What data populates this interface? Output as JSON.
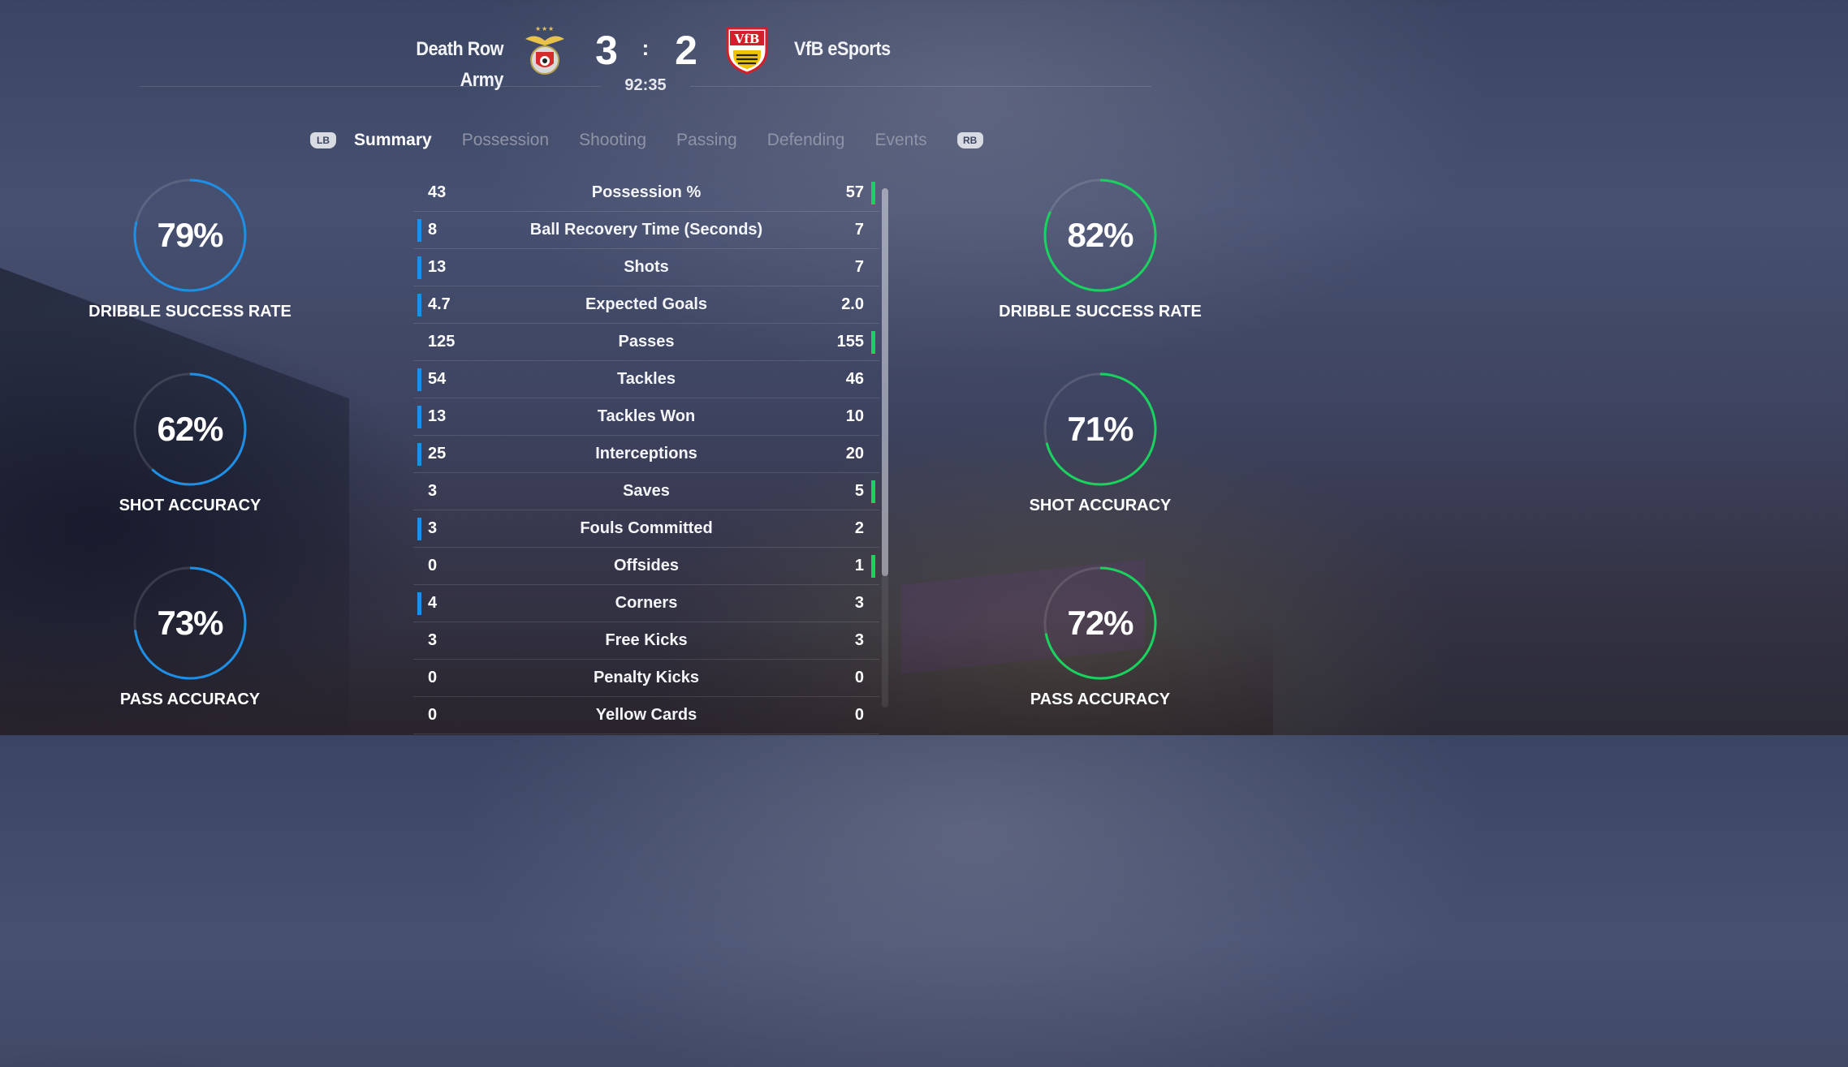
{
  "colors": {
    "home_accent": "#1e8fe6",
    "away_accent": "#19d35e"
  },
  "match": {
    "home_team": "Death Row Army",
    "away_team": "VfB eSports",
    "home_score": "3",
    "separator": ":",
    "away_score": "2",
    "clock": "92:35",
    "home_crest": "benfica-crest-icon",
    "away_crest": "vfb-stuttgart-crest-icon"
  },
  "tabs": {
    "lb": "LB",
    "rb": "RB",
    "items": [
      "Summary",
      "Possession",
      "Shooting",
      "Passing",
      "Defending",
      "Events"
    ],
    "active": "Summary"
  },
  "home_rings": [
    {
      "value": "79%",
      "label": "DRIBBLE SUCCESS RATE",
      "pct": 79
    },
    {
      "value": "62%",
      "label": "SHOT ACCURACY",
      "pct": 62
    },
    {
      "value": "73%",
      "label": "PASS ACCURACY",
      "pct": 73
    }
  ],
  "away_rings": [
    {
      "value": "82%",
      "label": "DRIBBLE SUCCESS RATE",
      "pct": 82
    },
    {
      "value": "71%",
      "label": "SHOT ACCURACY",
      "pct": 71
    },
    {
      "value": "72%",
      "label": "PASS ACCURACY",
      "pct": 72
    }
  ],
  "stats": [
    {
      "home": "43",
      "label": "Possession %",
      "away": "57",
      "leader": "away"
    },
    {
      "home": "8",
      "label": "Ball Recovery Time (Seconds)",
      "away": "7",
      "leader": "home"
    },
    {
      "home": "13",
      "label": "Shots",
      "away": "7",
      "leader": "home"
    },
    {
      "home": "4.7",
      "label": "Expected Goals",
      "away": "2.0",
      "leader": "home"
    },
    {
      "home": "125",
      "label": "Passes",
      "away": "155",
      "leader": "away"
    },
    {
      "home": "54",
      "label": "Tackles",
      "away": "46",
      "leader": "home"
    },
    {
      "home": "13",
      "label": "Tackles Won",
      "away": "10",
      "leader": "home"
    },
    {
      "home": "25",
      "label": "Interceptions",
      "away": "20",
      "leader": "home"
    },
    {
      "home": "3",
      "label": "Saves",
      "away": "5",
      "leader": "away"
    },
    {
      "home": "3",
      "label": "Fouls Committed",
      "away": "2",
      "leader": "home"
    },
    {
      "home": "0",
      "label": "Offsides",
      "away": "1",
      "leader": "away"
    },
    {
      "home": "4",
      "label": "Corners",
      "away": "3",
      "leader": "home"
    },
    {
      "home": "3",
      "label": "Free Kicks",
      "away": "3",
      "leader": "none"
    },
    {
      "home": "0",
      "label": "Penalty Kicks",
      "away": "0",
      "leader": "none"
    },
    {
      "home": "0",
      "label": "Yellow Cards",
      "away": "0",
      "leader": "none"
    }
  ]
}
